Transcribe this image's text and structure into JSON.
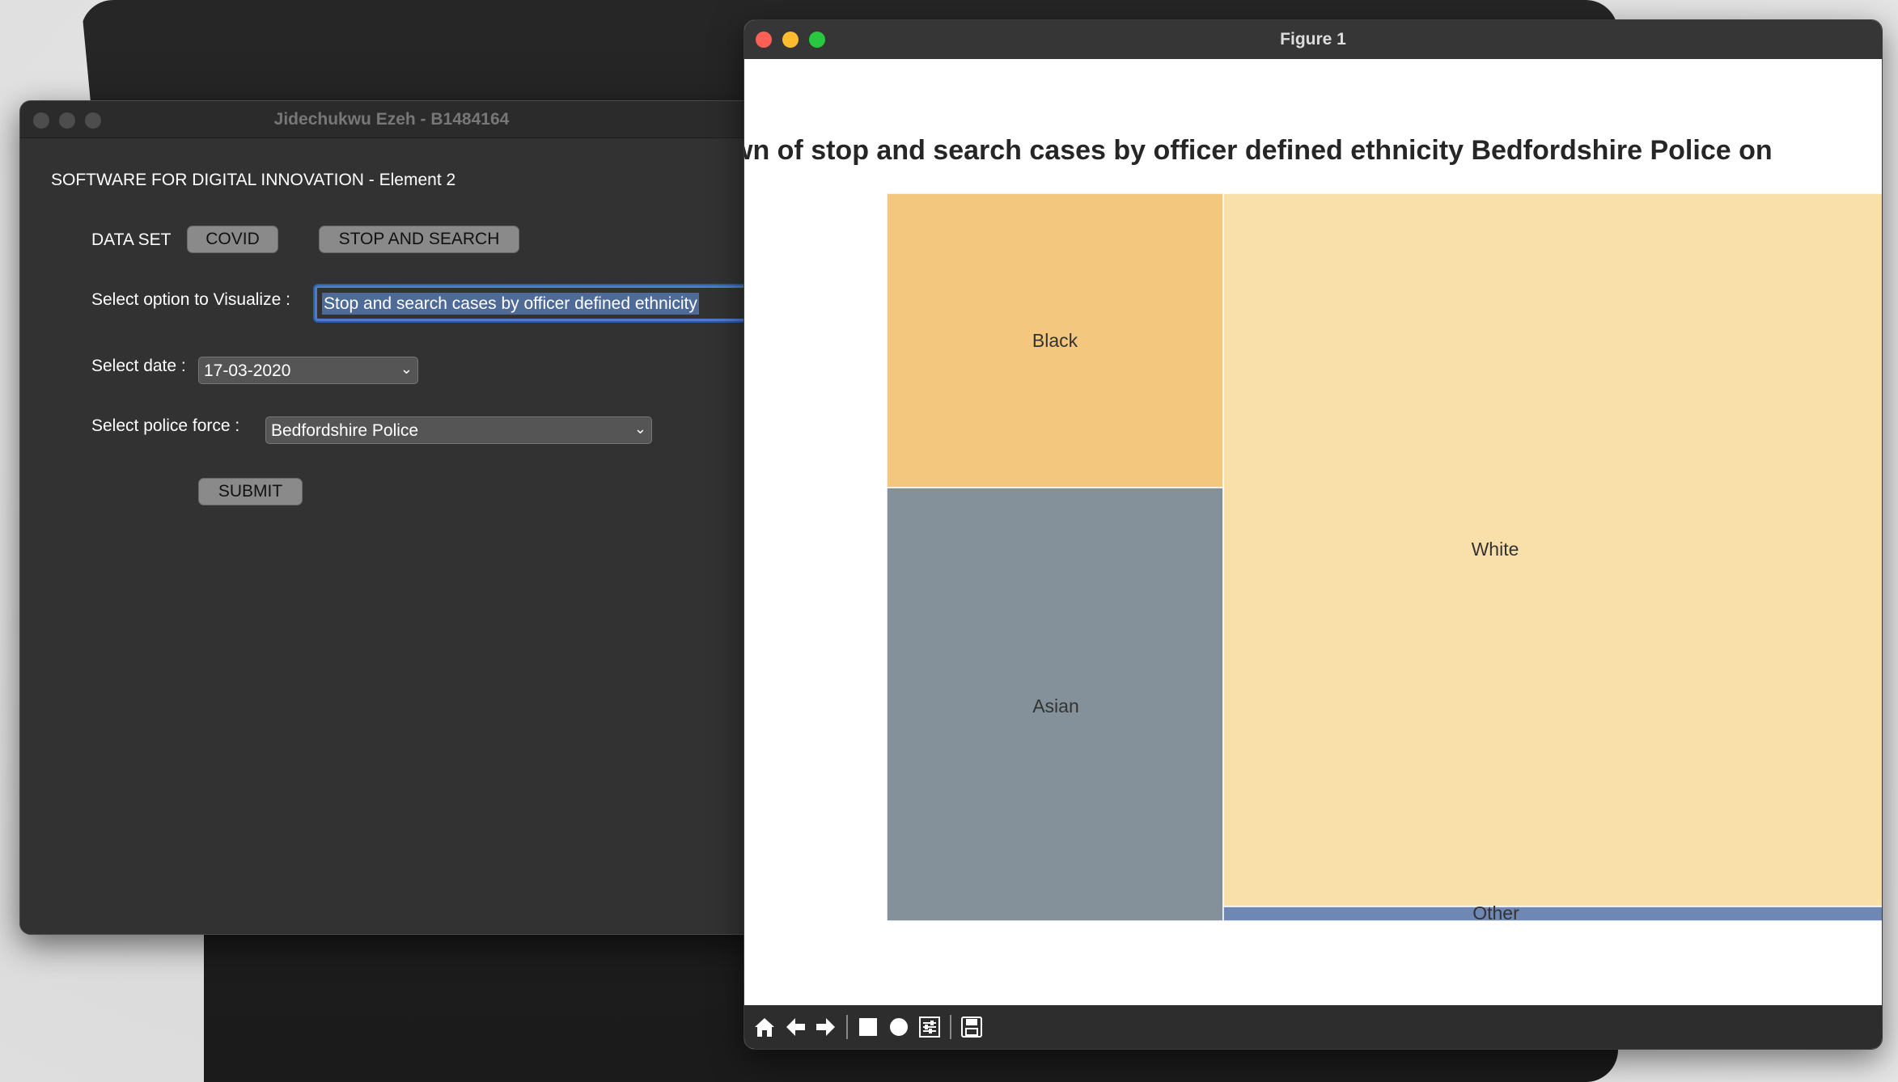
{
  "left_window": {
    "title": "Jidechukwu Ezeh - B1484164",
    "heading": "SOFTWARE FOR DIGITAL INNOVATION - Element 2",
    "dataset_label": "DATA SET",
    "covid_button": "COVID",
    "stop_search_button": "STOP AND SEARCH",
    "visualize_label": "Select option to Visualize :",
    "visualize_value": "Stop and search cases by officer defined ethnicity",
    "date_label": "Select date :",
    "date_value": "17-03-2020",
    "police_label": "Select police force :",
    "police_value": "Bedfordshire Police",
    "submit_button": "SUBMIT"
  },
  "figure_window": {
    "title": "Figure 1",
    "toolbar": {
      "icons": [
        "home-icon",
        "back-arrow-icon",
        "forward-arrow-icon",
        "pan-icon",
        "zoom-icon",
        "configure-subplots-icon",
        "save-icon"
      ]
    }
  },
  "chart_data": {
    "type": "treemap",
    "title": "wn of stop and search cases by officer defined ethnicity Bedfordshire Police on",
    "labels": [
      "Black",
      "Asian",
      "White",
      "Other"
    ],
    "colors": [
      "#F4C77E",
      "#84919A",
      "#F9E0AA",
      "#6F88B3"
    ]
  }
}
